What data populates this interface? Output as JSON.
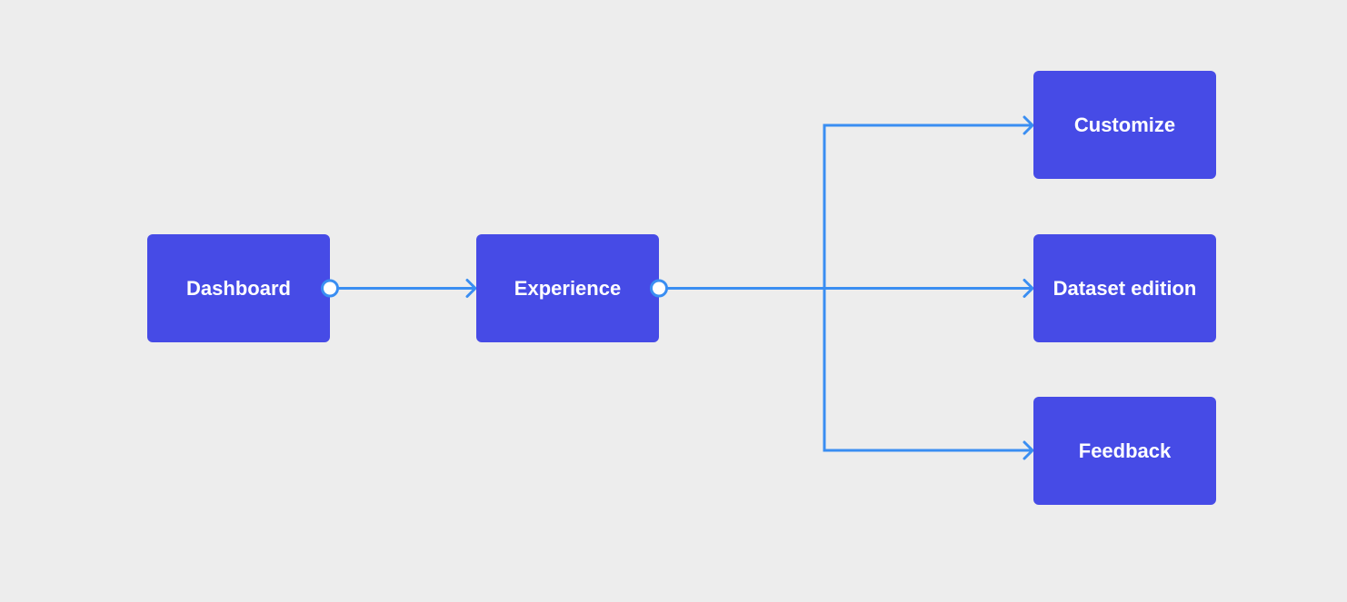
{
  "colors": {
    "background": "#ededed",
    "node": "#464be6",
    "node_text": "#ffffff",
    "connector": "#3a8ef2",
    "port_fill": "#ffffff"
  },
  "nodes": [
    {
      "id": "dashboard",
      "label": "Dashboard"
    },
    {
      "id": "experience",
      "label": "Experience"
    },
    {
      "id": "customize",
      "label": "Customize"
    },
    {
      "id": "dataset",
      "label": "Dataset edition"
    },
    {
      "id": "feedback",
      "label": "Feedback"
    }
  ],
  "edges": [
    {
      "from": "dashboard",
      "to": "experience"
    },
    {
      "from": "experience",
      "to": "customize"
    },
    {
      "from": "experience",
      "to": "dataset"
    },
    {
      "from": "experience",
      "to": "feedback"
    }
  ]
}
